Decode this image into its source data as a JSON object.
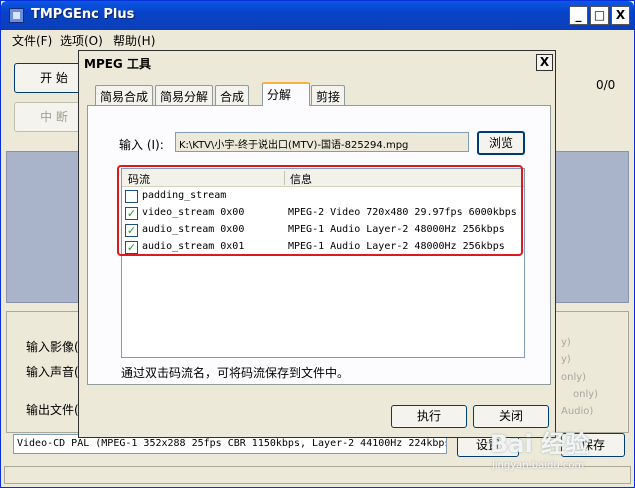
{
  "app": {
    "title": "TMPGEnc Plus",
    "minimize": "_",
    "maximize": "□",
    "close": "X"
  },
  "menu": [
    "文件(F)",
    "选项(O)",
    "帮助(H)"
  ],
  "toolbar": {
    "start_label": "开 始",
    "stop_label": "中 断",
    "counter": "0/0"
  },
  "lower": {
    "input_video": "输入影像(",
    "input_audio": "输入声音(",
    "output_file": "输出文件(",
    "ghost": [
      "y)",
      "y)",
      "only)",
      "only)",
      "Audio)"
    ]
  },
  "status_line": "Video-CD PAL (MPEG-1 352x288 25fps CBR 1150kbps,  Layer-2 44100Hz 224kbps",
  "bottom_buttons": {
    "settings_label": "设置",
    "save_label": "保存"
  },
  "dialog": {
    "title": "MPEG 工具",
    "close": "X",
    "tabs": [
      "简易合成",
      "简易分解",
      "合成",
      "分解",
      "剪接"
    ],
    "active_tab": 3,
    "input_label": "输入 (I):",
    "input_path": "K:\\KTV\\小宇-终于说出口(MTV)-国语-825294.mpg",
    "browse_label": "浏览",
    "list_headers": [
      "码流",
      "信息"
    ],
    "streams": [
      {
        "name": "padding_stream",
        "info": "",
        "checked": false
      },
      {
        "name": "video_stream 0x00",
        "info": "MPEG-2 Video 720x480 29.97fps 6000kbps",
        "checked": true
      },
      {
        "name": "audio_stream 0x00",
        "info": "MPEG-1 Audio Layer-2 48000Hz 256kbps",
        "checked": true
      },
      {
        "name": "audio_stream 0x01",
        "info": "MPEG-1 Audio Layer-2 48000Hz 256kbps",
        "checked": true
      }
    ],
    "hint": "通过双击码流名，可将码流保存到文件中。",
    "execute_label": "执行",
    "close_label": "关闭"
  },
  "watermark": {
    "text": "Bai 经验",
    "url": "jingyan.baidu.com"
  },
  "colors": {
    "titlebar": "#0a58e6",
    "highlight": "#e0181e",
    "panel": "#a9b4cb"
  }
}
